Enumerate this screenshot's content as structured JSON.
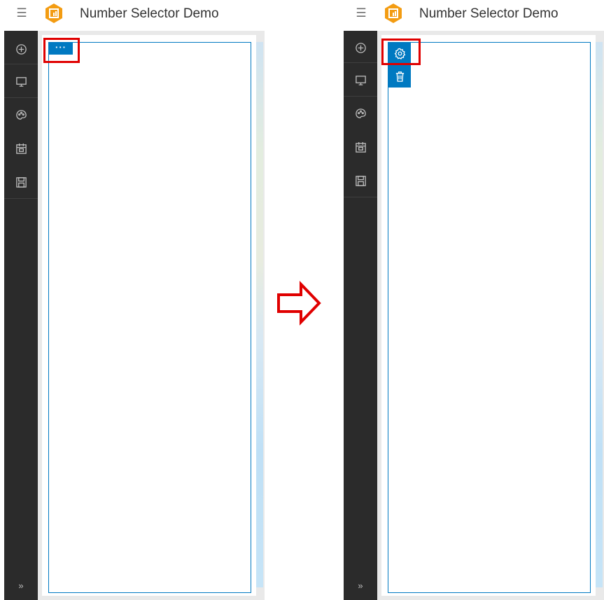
{
  "app": {
    "title": "Number Selector Demo"
  },
  "toolbar": {
    "items": [
      {
        "icon": "add-icon",
        "name": "add"
      },
      {
        "icon": "monitor-icon",
        "name": "preview"
      },
      {
        "icon": "palette-icon",
        "name": "theme"
      },
      {
        "icon": "calendar-icon",
        "name": "schedule"
      },
      {
        "icon": "save-icon",
        "name": "save"
      }
    ],
    "expand_label": "»"
  },
  "widget": {
    "more_label": "···"
  },
  "actions": [
    {
      "icon": "gear-icon",
      "name": "settings"
    },
    {
      "icon": "trash-icon",
      "name": "delete"
    }
  ],
  "colors": {
    "accent": "#0079c1",
    "highlight": "#e00000",
    "toolbar": "#2b2b2b",
    "logo": "#f39c12"
  }
}
